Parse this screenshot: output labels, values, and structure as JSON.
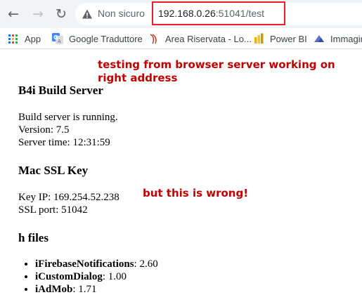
{
  "browser": {
    "security_label": "Non sicuro",
    "url_host": "192.168.0.26",
    "url_rest": ":51041/test",
    "icons": [
      "back-icon",
      "forward-icon",
      "reload-icon",
      "warning-icon"
    ]
  },
  "bookmarks": [
    {
      "label": "App",
      "icon": "apps-grid-icon"
    },
    {
      "label": "Google Traduttore",
      "icon": "google-translate-icon"
    },
    {
      "label": "Area Riservata - Lo...",
      "icon": "area-riservata-icon"
    },
    {
      "label": "Power BI",
      "icon": "power-bi-icon"
    },
    {
      "label": "Immagin",
      "icon": "immagini-icon"
    }
  ],
  "annotations": {
    "top": "testing from browser server working on right address",
    "middle": "but this is wrong!",
    "color": "#c00000"
  },
  "page": {
    "title": "B4i Build Server",
    "status": "Build server is running.",
    "version": "Version: 7.5",
    "server_time": "Server time: 12:31:59",
    "ssl_heading": "Mac SSL Key",
    "key_ip": "Key IP: 169.254.52.238",
    "ssl_port": "SSL port: 51042",
    "h_files_heading": "h files",
    "h_files": [
      {
        "name": "iFirebaseNotifications",
        "version": ": 2.60"
      },
      {
        "name": "iCustomDialog",
        "version": ": 1.00"
      },
      {
        "name": "iAdMob",
        "version": ": 1.71"
      }
    ]
  }
}
